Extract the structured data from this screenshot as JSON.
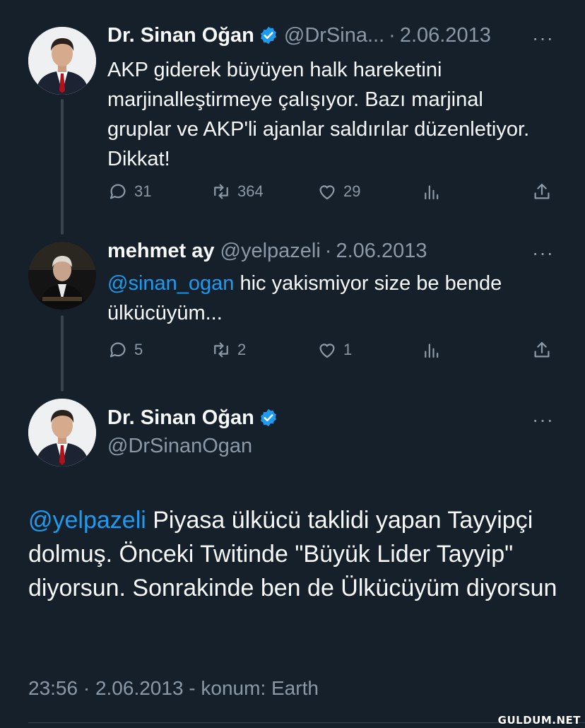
{
  "tweets": [
    {
      "name": "Dr. Sinan Oğan",
      "handle": "@DrSina...",
      "separator": "·",
      "date": "2.06.2013",
      "more": "···",
      "text": "AKP giderek büyüyen halk hareketini marjinalleştirmeye çalışıyor. Bazı marjinal gruplar ve AKP'li ajanlar saldırılar düzenletiyor. Dikkat!",
      "replies": "31",
      "retweets": "364",
      "likes": "29"
    },
    {
      "name": "mehmet ay",
      "handle": "@yelpazeli",
      "separator": "·",
      "date": "2.06.2013",
      "more": "···",
      "mention": "@sinan_ogan",
      "text": " hic yakismiyor size be bende ülkücüyüm...",
      "replies": "5",
      "retweets": "2",
      "likes": "1"
    }
  ],
  "main_tweet": {
    "name": "Dr. Sinan Oğan",
    "handle": "@DrSinanOgan",
    "more": "···",
    "mention": "@yelpazeli",
    "text": " Piyasa ülkücü taklidi yapan Tayyipçi dolmuş. Önceki Twitinde \"Büyük Lider Tayyip\" diyorsun. Sonrakinde ben de Ülkücüyüm diyorsun",
    "meta": "23:56 · 2.06.2013 - konum: Earth"
  },
  "watermark": "GULDUM.NET",
  "colors": {
    "background": "#15202b",
    "accent": "#1d9bf0",
    "muted": "#8b98a5",
    "text": "#f7f9f9"
  },
  "icons": [
    "verified-badge-icon",
    "reply-icon",
    "retweet-icon",
    "like-icon",
    "analytics-icon",
    "share-icon",
    "more-icon"
  ]
}
